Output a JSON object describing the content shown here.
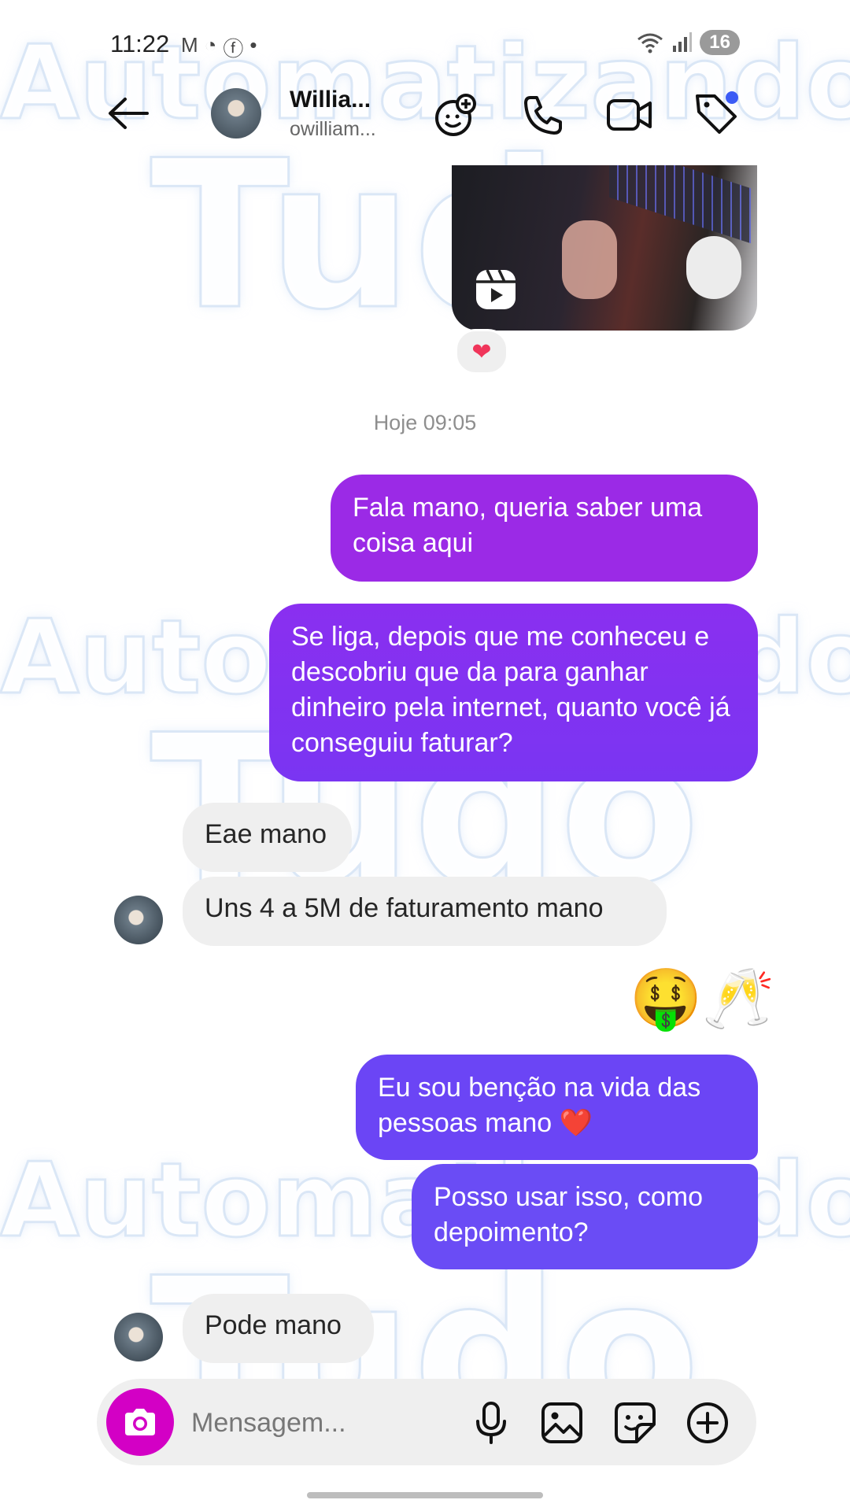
{
  "status_bar": {
    "time": "11:22",
    "battery": "16"
  },
  "header": {
    "name": "Willia...",
    "handle": "owilliam..."
  },
  "timestamp": "Hoje 09:05",
  "reaction": "❤",
  "messages": [
    {
      "text": "Fala mano, queria saber uma coisa aqui"
    },
    {
      "text": "Se liga, depois que me conheceu e descobriu que da para ganhar dinheiro pela internet, quanto você já conseguiu faturar?"
    },
    {
      "text": "Eae mano"
    },
    {
      "text": "Uns 4 a 5M de faturamento mano"
    },
    {
      "text": "🤑🥂"
    },
    {
      "text": "Eu sou benção na vida das pessoas mano ❤️"
    },
    {
      "text": "Posso usar isso, como depoimento?"
    },
    {
      "text": "Pode mano"
    }
  ],
  "composer": {
    "placeholder": "Mensagem..."
  },
  "watermark": {
    "line1": "Automatizando",
    "line2": "Tudo"
  },
  "colors": {
    "bubble_top": "#9b2ae6",
    "bubble_mid": "#7c34f0",
    "bubble_bottom": "#6a4cf5",
    "camera": "#d300c5",
    "incoming": "#efefef"
  }
}
